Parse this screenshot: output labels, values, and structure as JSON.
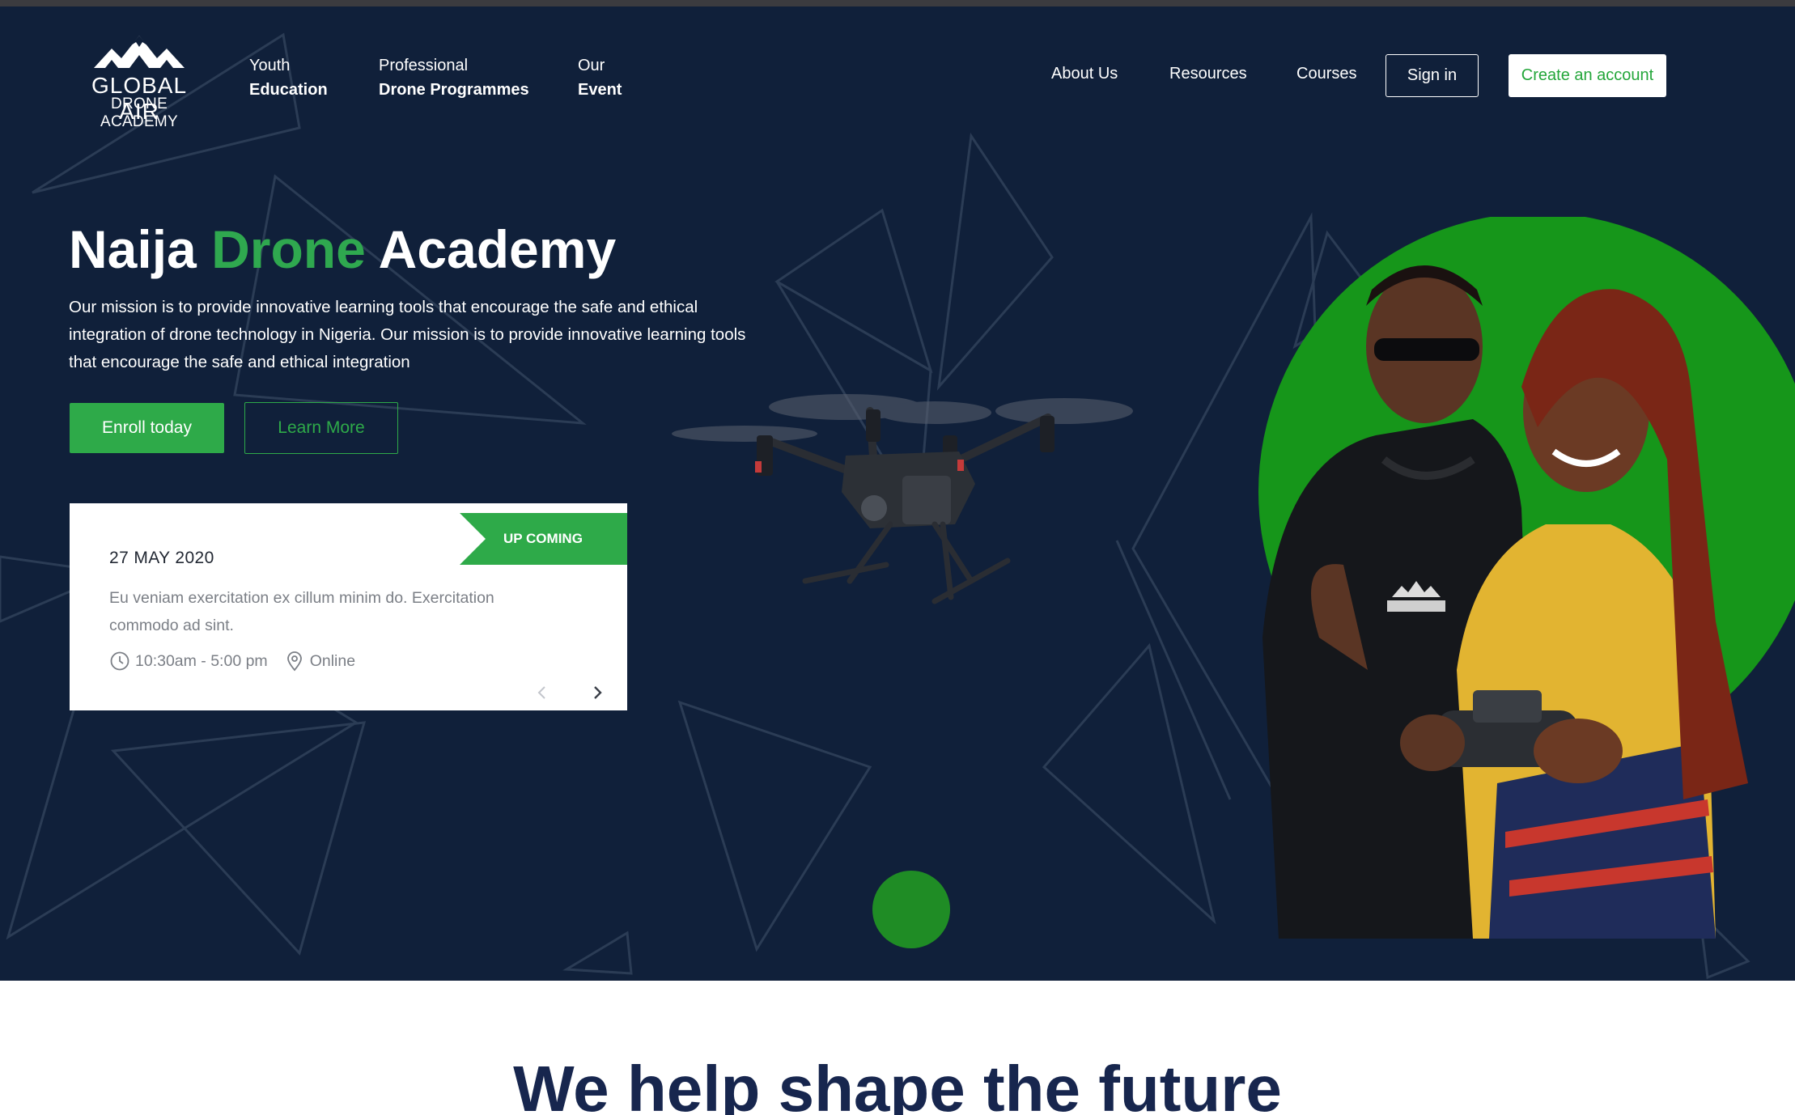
{
  "brand": {
    "logo_line1": "GLOBAL AIR",
    "logo_line2": "DRONE ACADEMY",
    "logo_icon": "mountain-peaks-icon"
  },
  "nav": {
    "left_items": [
      {
        "line1": "Youth",
        "line2": "Education"
      },
      {
        "line1": "Professional",
        "line2": "Drone Programmes"
      },
      {
        "line1": "Our",
        "line2": "Event"
      }
    ],
    "right_links": [
      "About Us",
      "Resources",
      "Courses"
    ],
    "sign_in": "Sign in",
    "create_account": "Create an account"
  },
  "hero": {
    "title_part1": "Naija ",
    "title_accent": "Drone",
    "title_part2": " Academy",
    "description": "Our mission is to provide innovative learning tools that encourage the safe and ethical integration of drone technology in Nigeria. Our mission is to provide innovative learning tools that encourage the safe and ethical integration",
    "enroll_label": "Enroll today",
    "learn_more_label": "Learn More"
  },
  "event": {
    "badge": "UP COMING",
    "date": "27 MAY 2020",
    "description": "Eu veniam exercitation ex cillum minim do. Exercitation commodo ad sint.",
    "time": "10:30am - 5:00 pm",
    "location": "Online",
    "time_icon": "clock-icon",
    "location_icon": "map-pin-icon",
    "prev_icon": "chevron-left-icon",
    "next_icon": "chevron-right-icon"
  },
  "section": {
    "title": "We help shape the future"
  },
  "colors": {
    "hero_bg": "#10203a",
    "accent_green": "#2eaa49",
    "photo_circle": "#16961a",
    "heading_navy": "#17264e"
  }
}
